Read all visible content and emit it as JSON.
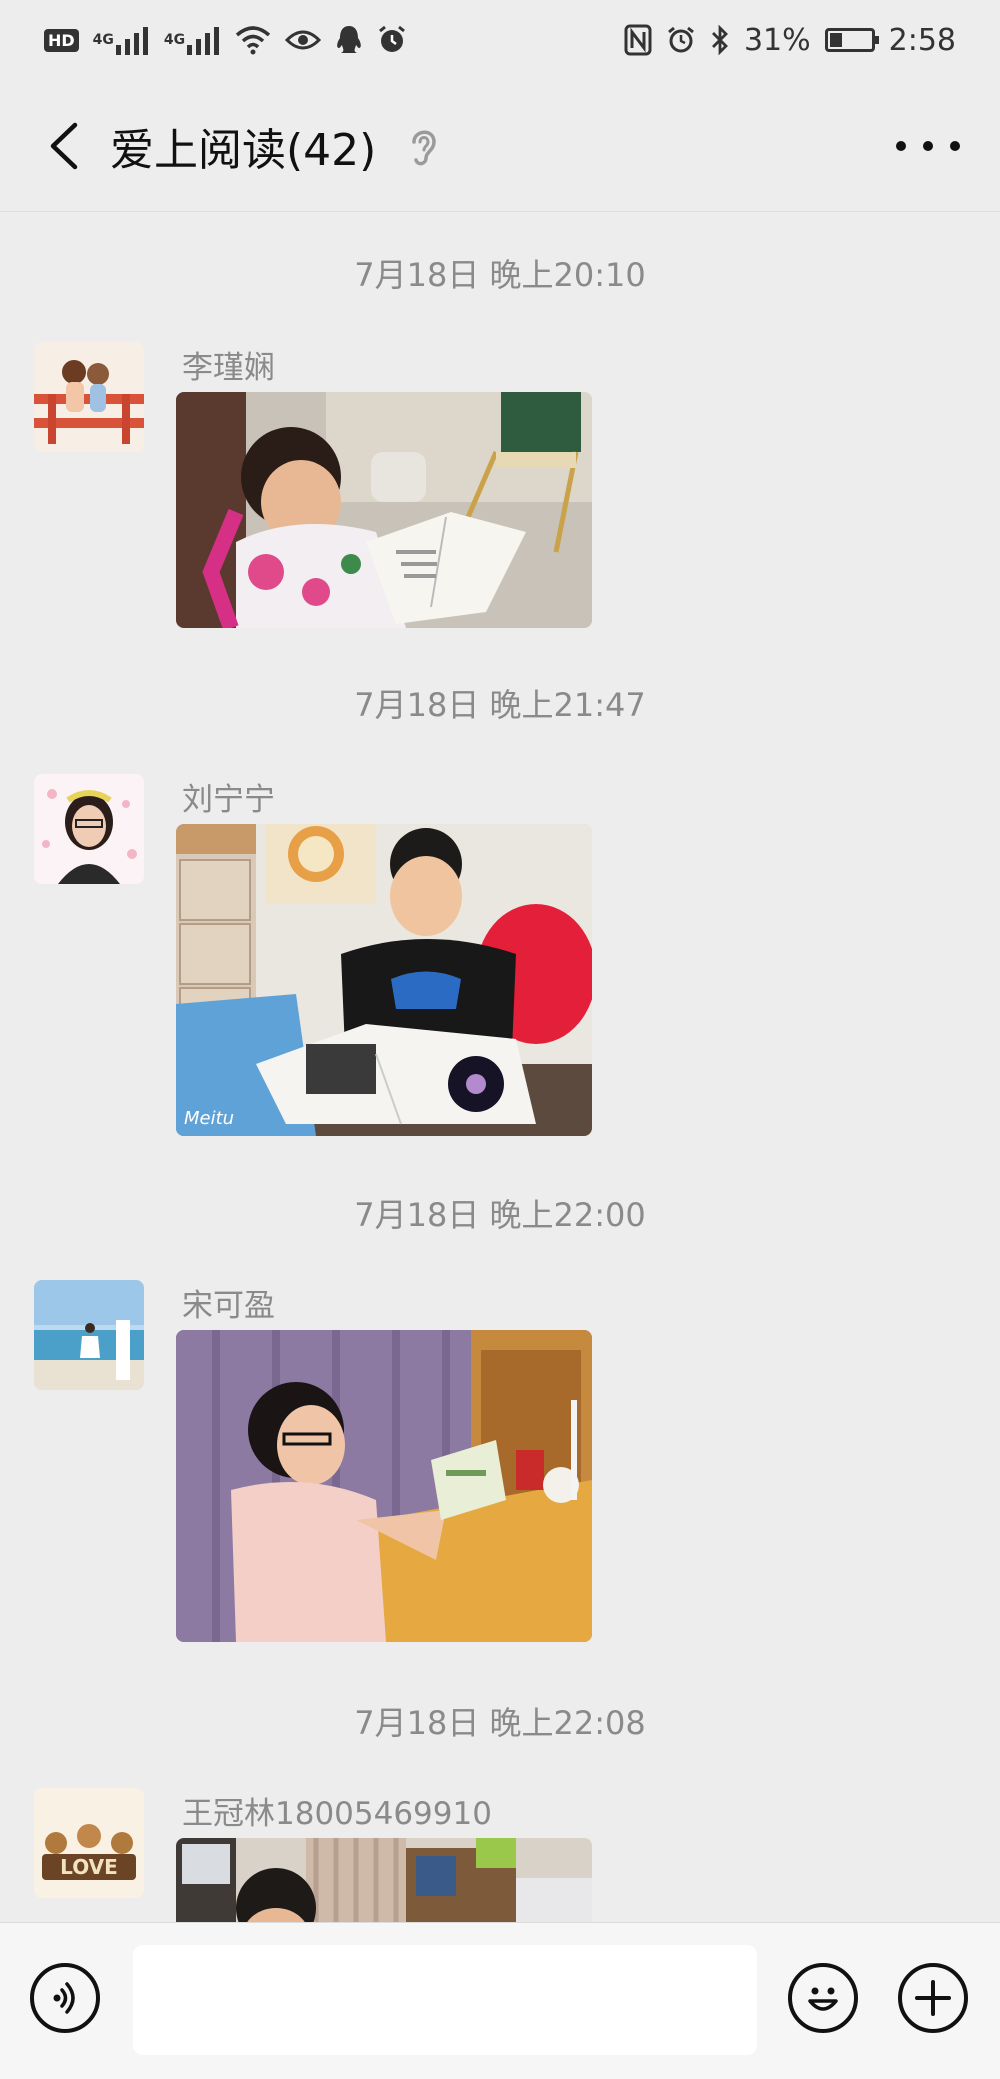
{
  "status_bar": {
    "hd": "HD",
    "net1": "4G",
    "net2": "4G",
    "battery_text": "31%",
    "battery_level": 0.31,
    "time": "2:58"
  },
  "header": {
    "title": "爱上阅读(42)"
  },
  "messages": [
    {
      "time": "7月18日 晚上20:10",
      "sender": "李瑾娴"
    },
    {
      "time": "7月18日 晚上21:47",
      "sender": "刘宁宁",
      "watermark": "Meitu"
    },
    {
      "time": "7月18日 晚上22:00",
      "sender": "宋可盈"
    },
    {
      "time": "7月18日 晚上22:08",
      "sender": "王冠林18005469910",
      "avatar_text": "LOVE"
    }
  ],
  "input_bar": {
    "placeholder": ""
  },
  "colors": {
    "background": "#ededed",
    "meta_text": "#8a8a8a",
    "input_bar": "#f6f6f6"
  },
  "icons": [
    "back-arrow-icon",
    "ear-icon",
    "more-icon",
    "voice-icon",
    "emoji-icon",
    "plus-icon"
  ]
}
